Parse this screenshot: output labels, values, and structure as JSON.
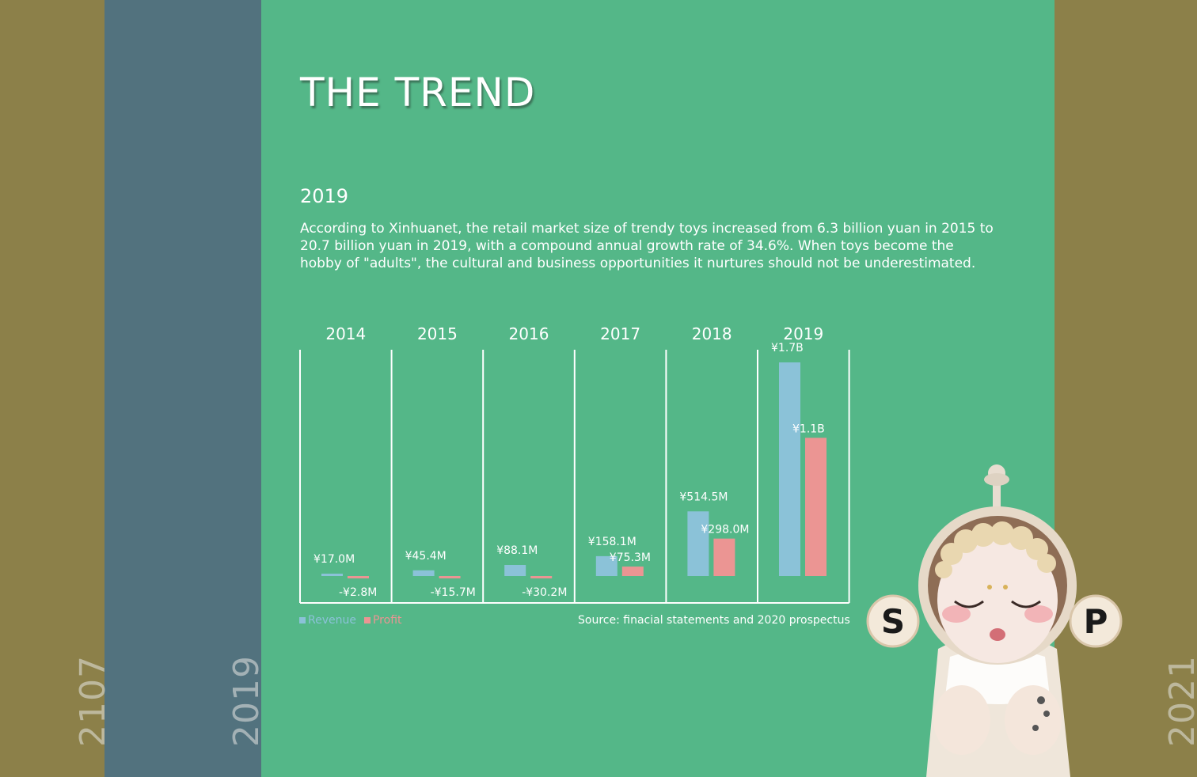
{
  "colors": {
    "olive": "#8c8049",
    "blue": "#52727e",
    "green": "#54b788",
    "revenue": "#8bc2d8",
    "profit": "#eb9593"
  },
  "side": {
    "left_year": "2107",
    "mid_year": "2019",
    "right_year": "2021"
  },
  "panel": {
    "title": "THE TREND",
    "year": "2019",
    "paragraph": "According to Xinhuanet, the retail market size of trendy toys increased from 6.3 billion yuan in 2015 to 20.7 billion yuan in 2019, with a compound annual growth rate of 34.6%. When toys become the hobby of \"adults\", the cultural and business opportunities it nurtures should not be underestimated.",
    "source": "Source: finacial statements and 2020 prospectus"
  },
  "figure": {
    "icon": "sp-astronaut-doll-figure",
    "letters": [
      "S",
      "P"
    ]
  },
  "chart_data": {
    "type": "bar",
    "categories": [
      "2014",
      "2015",
      "2016",
      "2017",
      "2018",
      "2019"
    ],
    "series": [
      {
        "name": "Revenue",
        "values": [
          17.0,
          45.4,
          88.1,
          158.1,
          514.5,
          1700
        ],
        "labels": [
          "¥17.0M",
          "¥45.4M",
          "¥88.1M",
          "¥158.1M",
          "¥514.5M",
          "¥1.7B"
        ]
      },
      {
        "name": "Profit",
        "values": [
          -2.8,
          -15.7,
          -30.2,
          75.3,
          298.0,
          1100
        ],
        "labels": [
          "-¥2.8M",
          "-¥15.7M",
          "-¥30.2M",
          "¥75.3M",
          "¥298.0M",
          "¥1.1B"
        ]
      }
    ],
    "unit": "million yuan",
    "ylim": [
      -30.2,
      1700
    ],
    "grid": false,
    "legend": "bottom-left"
  }
}
